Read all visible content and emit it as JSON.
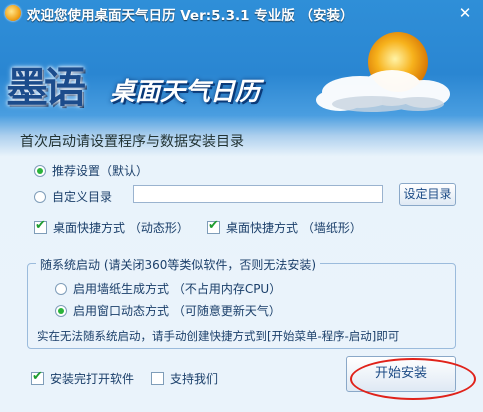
{
  "titlebar": {
    "title": "欢迎您使用桌面天气日历 Ver:5.3.1 专业版 （安装）",
    "close_label": "✕"
  },
  "banner": {
    "logo_text": "墨语",
    "brand_text": "桌面天气日历"
  },
  "heading": "首次启动请设置程序与数据安装目录",
  "install_mode": {
    "recommended_label": "推荐设置（默认）",
    "recommended_selected": true,
    "custom_label": "自定义目录",
    "custom_selected": false,
    "dir_value": "",
    "set_dir_button": "设定目录"
  },
  "shortcuts": {
    "dynamic_label": "桌面快捷方式 （动态形）",
    "dynamic_checked": true,
    "wallpaper_label": "桌面快捷方式 （墙纸形）",
    "wallpaper_checked": true
  },
  "startup_group": {
    "title": "随系统启动 (请关闭360等类似软件，否则无法安装)",
    "option_wallpaper": "启用墙纸生成方式 （不占用内存CPU）",
    "option_wallpaper_selected": false,
    "option_window": "启用窗口动态方式 （可随意更新天气）",
    "option_window_selected": true,
    "note": "实在无法随系统启动，请手动创建快捷方式到[开始菜单-程序-启动]即可"
  },
  "footer": {
    "open_after_label": "安装完打开软件",
    "open_after_checked": true,
    "support_label": "支持我们",
    "support_checked": false,
    "start_button": "开始安装"
  },
  "colors": {
    "accent": "#2a86d2",
    "highlight_ellipse": "#e0221a",
    "check_green": "#1e9c2f"
  }
}
